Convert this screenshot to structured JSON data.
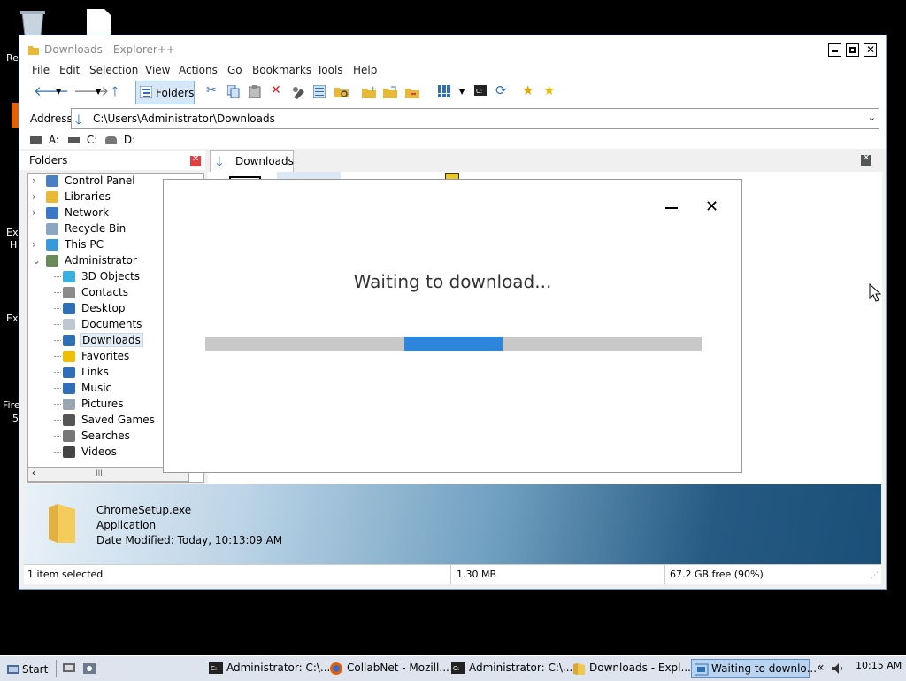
{
  "desktop": {
    "labels": [
      "Re",
      "Ex",
      "H",
      "Ex",
      "Fire",
      "5"
    ]
  },
  "window": {
    "title": "Downloads - Explorer++",
    "menu": [
      "File",
      "Edit",
      "Selection",
      "View",
      "Actions",
      "Go",
      "Bookmarks",
      "Tools",
      "Help"
    ],
    "toolbar": {
      "folders_label": "Folders"
    },
    "address": {
      "label": "Address",
      "path": "C:\\Users\\Administrator\\Downloads"
    },
    "drives": [
      "A:",
      "C:",
      "D:"
    ],
    "folders_header": "Folders",
    "tree": [
      {
        "label": "Control Panel",
        "level": 0,
        "expander": "›",
        "icon": "control-panel-icon"
      },
      {
        "label": "Libraries",
        "level": 0,
        "expander": "›",
        "icon": "libraries-icon"
      },
      {
        "label": "Network",
        "level": 0,
        "expander": "›",
        "icon": "network-icon"
      },
      {
        "label": "Recycle Bin",
        "level": 0,
        "expander": "",
        "icon": "recycle-bin-icon"
      },
      {
        "label": "This PC",
        "level": 0,
        "expander": "›",
        "icon": "this-pc-icon"
      },
      {
        "label": "Administrator",
        "level": 0,
        "expander": "⌄",
        "icon": "user-icon"
      },
      {
        "label": "3D Objects",
        "level": 1,
        "icon": "3d-objects-icon"
      },
      {
        "label": "Contacts",
        "level": 1,
        "icon": "contacts-icon"
      },
      {
        "label": "Desktop",
        "level": 1,
        "icon": "desktop-folder-icon"
      },
      {
        "label": "Documents",
        "level": 1,
        "icon": "documents-icon"
      },
      {
        "label": "Downloads",
        "level": 1,
        "icon": "downloads-icon",
        "selected": true
      },
      {
        "label": "Favorites",
        "level": 1,
        "icon": "favorites-star-icon"
      },
      {
        "label": "Links",
        "level": 1,
        "icon": "links-icon"
      },
      {
        "label": "Music",
        "level": 1,
        "icon": "music-icon"
      },
      {
        "label": "Pictures",
        "level": 1,
        "icon": "pictures-icon"
      },
      {
        "label": "Saved Games",
        "level": 1,
        "icon": "saved-games-icon"
      },
      {
        "label": "Searches",
        "level": 1,
        "icon": "searches-icon"
      },
      {
        "label": "Videos",
        "level": 1,
        "icon": "videos-icon"
      }
    ],
    "tab": {
      "label": "Downloads"
    },
    "details": {
      "filename": "ChromeSetup.exe",
      "type": "Application",
      "modified": "Date Modified: Today, 10:13:09 AM"
    },
    "status": {
      "selection": "1 item selected",
      "size": "1.30 MB",
      "free": "67.2 GB free (90%)"
    }
  },
  "dialog": {
    "message": "Waiting to download...",
    "progress_indeterminate": true
  },
  "taskbar": {
    "start_label": "Start",
    "tasks": [
      {
        "label": "Administrator: C:\\...",
        "icon": "cmd-icon"
      },
      {
        "label": "CollabNet - Mozill...",
        "icon": "firefox-icon"
      },
      {
        "label": "Administrator: C:\\...",
        "icon": "cmd-icon"
      },
      {
        "label": "Downloads - Expl...",
        "icon": "folder-icon"
      },
      {
        "label": "Waiting to downlo...",
        "icon": "installer-icon",
        "active": true
      }
    ],
    "clock": "10:15 AM"
  },
  "colors": {
    "accent": "#2e86dc",
    "window_border": "#6e9fd1",
    "taskbar_bg": "#dde4ee"
  }
}
